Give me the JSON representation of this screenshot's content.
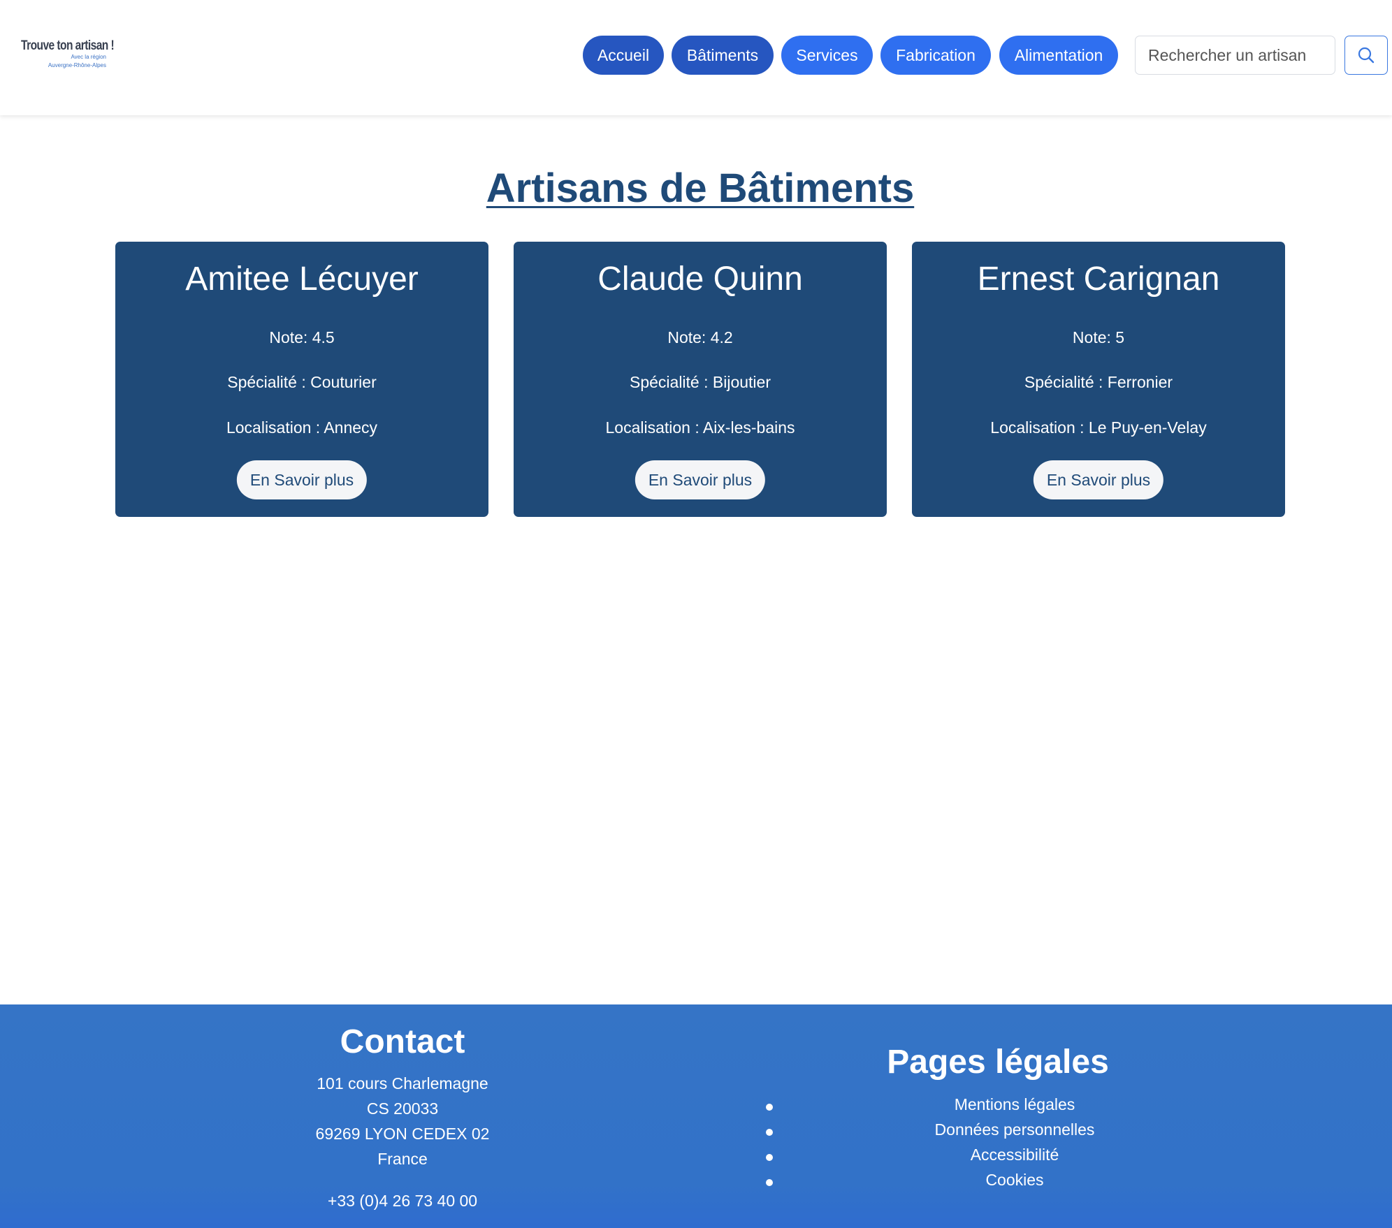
{
  "brand": {
    "logo_title": "Trouve ton artisan !",
    "logo_sub1": "Avec la région",
    "logo_sub2": "Auvergne-Rhône-Alpes",
    "primary_color": "#1f4a78",
    "accent_color": "#2f6ff0",
    "active_nav_color": "#2656c0",
    "footer_color": "#3272c8"
  },
  "nav": {
    "items": [
      {
        "label": "Accueil"
      },
      {
        "label": "Bâtiments"
      },
      {
        "label": "Services"
      },
      {
        "label": "Fabrication"
      },
      {
        "label": "Alimentation"
      }
    ]
  },
  "search": {
    "placeholder": "Rechercher un artisan",
    "icon": "search-icon"
  },
  "main": {
    "title": "Artisans de Bâtiments",
    "cards": [
      {
        "name": "Amitee Lécuyer",
        "note": "Note: 4.5",
        "speciality": "Spécialité : Couturier",
        "location": "Localisation : Annecy",
        "button": "En Savoir plus"
      },
      {
        "name": "Claude Quinn",
        "note": "Note: 4.2",
        "speciality": "Spécialité : Bijoutier",
        "location": "Localisation : Aix-les-bains",
        "button": "En Savoir plus"
      },
      {
        "name": "Ernest Carignan",
        "note": "Note: 5",
        "speciality": "Spécialité : Ferronier",
        "location": "Localisation : Le Puy-en-Velay",
        "button": "En Savoir plus"
      }
    ]
  },
  "footer": {
    "contact": {
      "title": "Contact",
      "lines": [
        "101 cours Charlemagne",
        "CS 20033",
        "69269 LYON CEDEX 02",
        "France"
      ],
      "phone": "+33 (0)4 26 73 40 00"
    },
    "legal": {
      "title": "Pages légales",
      "items": [
        "Mentions légales",
        "Données personnelles",
        "Accessibilité",
        "Cookies"
      ]
    }
  }
}
